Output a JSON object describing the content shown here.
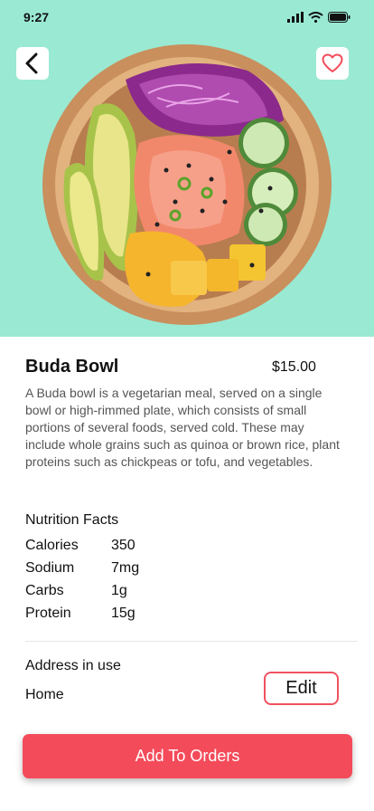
{
  "status_bar": {
    "time": "9:27",
    "icons": [
      "signal-icon",
      "wifi-icon",
      "battery-icon"
    ]
  },
  "header": {
    "back_icon": "chevron-left-icon",
    "favorite_icon": "heart-outline-icon"
  },
  "product": {
    "name": "Buda Bowl",
    "price": "$15.00",
    "description": "A Buda bowl is a vegetarian meal, served on a single bowl or high-rimmed plate, which consists of small portions of several foods, served cold. These may include whole grains such as quinoa or brown rice, plant proteins such as chickpeas or tofu, and vegetables."
  },
  "nutrition": {
    "title": "Nutrition Facts",
    "rows": [
      {
        "label": "Calories",
        "value": "350"
      },
      {
        "label": "Sodium",
        "value": "7mg"
      },
      {
        "label": "Carbs",
        "value": "1g"
      },
      {
        "label": "Protein",
        "value": "15g"
      }
    ]
  },
  "address": {
    "title": "Address in use",
    "value": "Home",
    "edit_label": "Edit"
  },
  "actions": {
    "add_to_orders_label": "Add To Orders"
  },
  "colors": {
    "accent": "#f44b5a",
    "hero_background": "#9ae9d3"
  }
}
